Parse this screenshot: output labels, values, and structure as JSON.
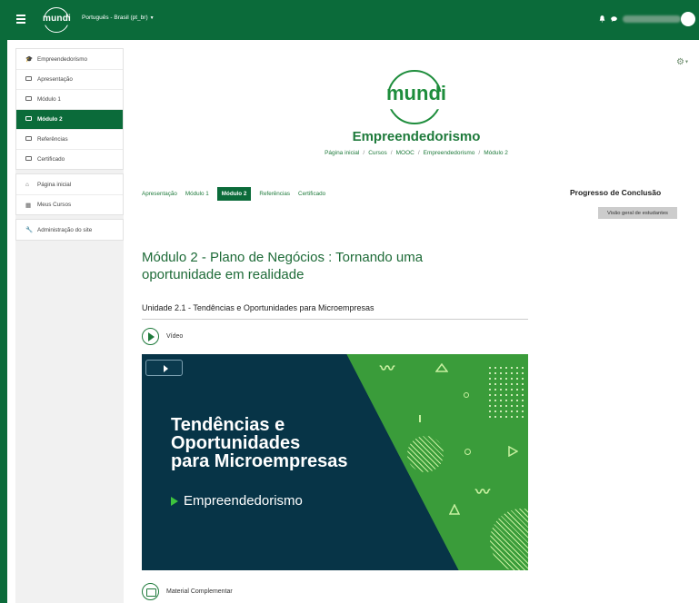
{
  "navbar": {
    "logo_text": "mundi",
    "language": "Português - Brasil (pt_br)",
    "colors": {
      "brand_green": "#0b6b3a"
    }
  },
  "sidebar": {
    "course_items": [
      {
        "label": "Empreendedorismo",
        "icon": "graduation-cap-icon"
      },
      {
        "label": "Apresentação",
        "icon": "folder-icon"
      },
      {
        "label": "Módulo 1",
        "icon": "folder-icon"
      },
      {
        "label": "Módulo 2",
        "icon": "folder-icon",
        "active": true
      },
      {
        "label": "Referências",
        "icon": "folder-icon"
      },
      {
        "label": "Certificado",
        "icon": "folder-icon"
      }
    ],
    "nav_items": [
      {
        "label": "Página inicial",
        "icon": "home-icon"
      },
      {
        "label": "Meus Cursos",
        "icon": "courses-icon"
      }
    ],
    "admin_items": [
      {
        "label": "Administração do site",
        "icon": "wrench-icon"
      }
    ]
  },
  "header": {
    "logo_text": "mundi",
    "course_title": "Empreendedorismo",
    "breadcrumb": [
      "Página inicial",
      "Cursos",
      "MOOC",
      "Empreendedorismo",
      "Módulo 2"
    ]
  },
  "tabs": [
    "Apresentação",
    "Módulo 1",
    "Módulo 2",
    "Referências",
    "Certificado"
  ],
  "progress": {
    "title": "Progresso de Conclusão",
    "button": "Visão geral de estudantes"
  },
  "main": {
    "module_title": "Módulo 2 - Plano de Negócios : Tornando uma oportunidade em realidade",
    "unit_title": "Unidade 2.1 - Tendências e Oportunidades para Microempresas",
    "video_label": "Vídeo",
    "video_title": "Tendências e\nOportunidades\npara Microempresas",
    "video_subtitle": "Empreendedorismo",
    "material_label": "Material Complementar"
  }
}
